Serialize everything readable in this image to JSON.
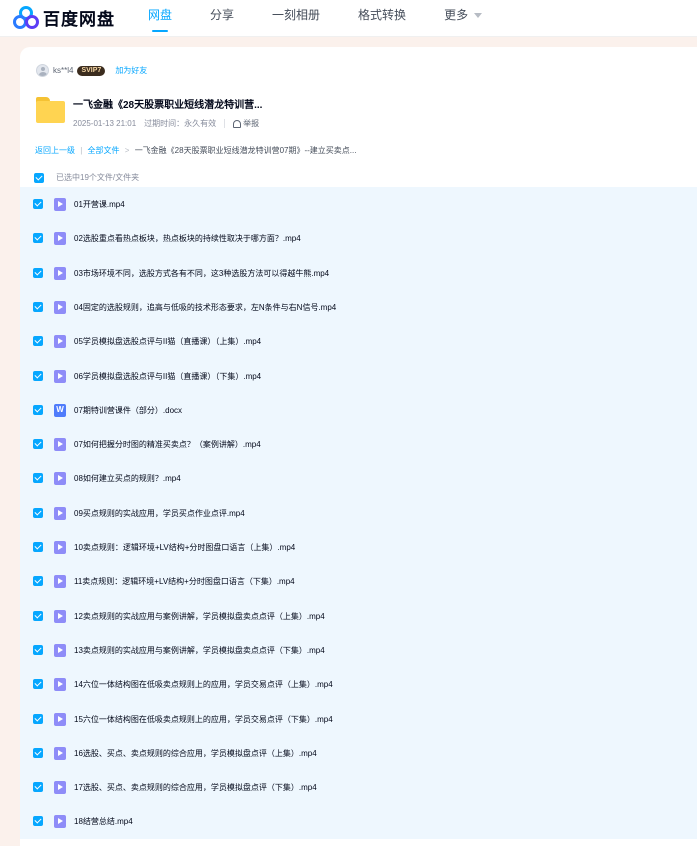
{
  "brand": {
    "name": "百度网盘",
    "colors": [
      "#06a7ff",
      "#2b7bff",
      "#5b3df5"
    ]
  },
  "nav": {
    "items": [
      {
        "label": "网盘",
        "active": true
      },
      {
        "label": "分享",
        "active": false
      },
      {
        "label": "一刻相册",
        "active": false
      },
      {
        "label": "格式转换",
        "active": false
      }
    ],
    "more_label": "更多"
  },
  "sharer": {
    "username": "ks**l4",
    "badge": "SVIP7",
    "add_friend_label": "加为好友"
  },
  "share": {
    "title": "一飞金融《28天股票职业短线潜龙特训营...",
    "date": "2025-01-13 21:01",
    "expiry": "过期时间：永久有效",
    "report_label": "举报"
  },
  "breadcrumb": {
    "back_label": "返回上一级",
    "sep": "|",
    "all_files_label": "全部文件",
    "arrow": ">",
    "current": "一飞金融《28天股票职业短线潜龙特训营07期》--建立买卖点..."
  },
  "selection": {
    "label": "已选中19个文件/文件夹",
    "checked": true
  },
  "files": [
    {
      "name": "01开营课.mp4",
      "type": "video",
      "icon": "video-file-icon",
      "checked": true
    },
    {
      "name": "02选股重点看热点板块，热点板块的持续性取决于哪方面？.mp4",
      "type": "video",
      "icon": "video-file-icon",
      "checked": true
    },
    {
      "name": "03市场环境不同，选股方式各有不同，这3种选股方法可以得越牛熊.mp4",
      "type": "video",
      "icon": "video-file-icon",
      "checked": true
    },
    {
      "name": "04固定的选股规则，追高与低吸的技术形态要求，左N条件与右N信号.mp4",
      "type": "video",
      "icon": "video-file-icon",
      "checked": true
    },
    {
      "name": "05学员模拟盘选股点评与II猫（直播课）（上集）.mp4",
      "type": "video",
      "icon": "video-file-icon",
      "checked": true
    },
    {
      "name": "06学员模拟盘选股点评与II猫（直播课）（下集）.mp4",
      "type": "video",
      "icon": "video-file-icon",
      "checked": true
    },
    {
      "name": "07期特训营课件（部分）.docx",
      "type": "doc",
      "icon": "word-file-icon",
      "checked": true
    },
    {
      "name": "07如何把握分时图的精准买卖点？（案例讲解）.mp4",
      "type": "video",
      "icon": "video-file-icon",
      "checked": true
    },
    {
      "name": "08如何建立买点的规则？.mp4",
      "type": "video",
      "icon": "video-file-icon",
      "checked": true
    },
    {
      "name": "09买点规则的实战应用，学员买点作业点评.mp4",
      "type": "video",
      "icon": "video-file-icon",
      "checked": true
    },
    {
      "name": "10卖点规则：逻辑环境+LV结构+分时图盘口语言（上集）.mp4",
      "type": "video",
      "icon": "video-file-icon",
      "checked": true
    },
    {
      "name": "11卖点规则：逻辑环境+LV结构+分时图盘口语言（下集）.mp4",
      "type": "video",
      "icon": "video-file-icon",
      "checked": true
    },
    {
      "name": "12卖点规则的实战应用与案例讲解，学员模拟盘卖点点评（上集）.mp4",
      "type": "video",
      "icon": "video-file-icon",
      "checked": true
    },
    {
      "name": "13卖点规则的实战应用与案例讲解，学员模拟盘卖点点评（下集）.mp4",
      "type": "video",
      "icon": "video-file-icon",
      "checked": true
    },
    {
      "name": "14六位一体结构图在低吸卖点规则上的应用，学员交易点评（上集）.mp4",
      "type": "video",
      "icon": "video-file-icon",
      "checked": true
    },
    {
      "name": "15六位一体结构图在低吸卖点规则上的应用，学员交易点评（下集）.mp4",
      "type": "video",
      "icon": "video-file-icon",
      "checked": true
    },
    {
      "name": "16选股、买点、卖点规则的综合应用，学员模拟盘点评（上集）.mp4",
      "type": "video",
      "icon": "video-file-icon",
      "checked": true
    },
    {
      "name": "17选股、买点、卖点规则的综合应用，学员模拟盘点评（下集）.mp4",
      "type": "video",
      "icon": "video-file-icon",
      "checked": true
    },
    {
      "name": "18结营总结.mp4",
      "type": "video",
      "icon": "video-file-icon",
      "checked": true
    }
  ]
}
